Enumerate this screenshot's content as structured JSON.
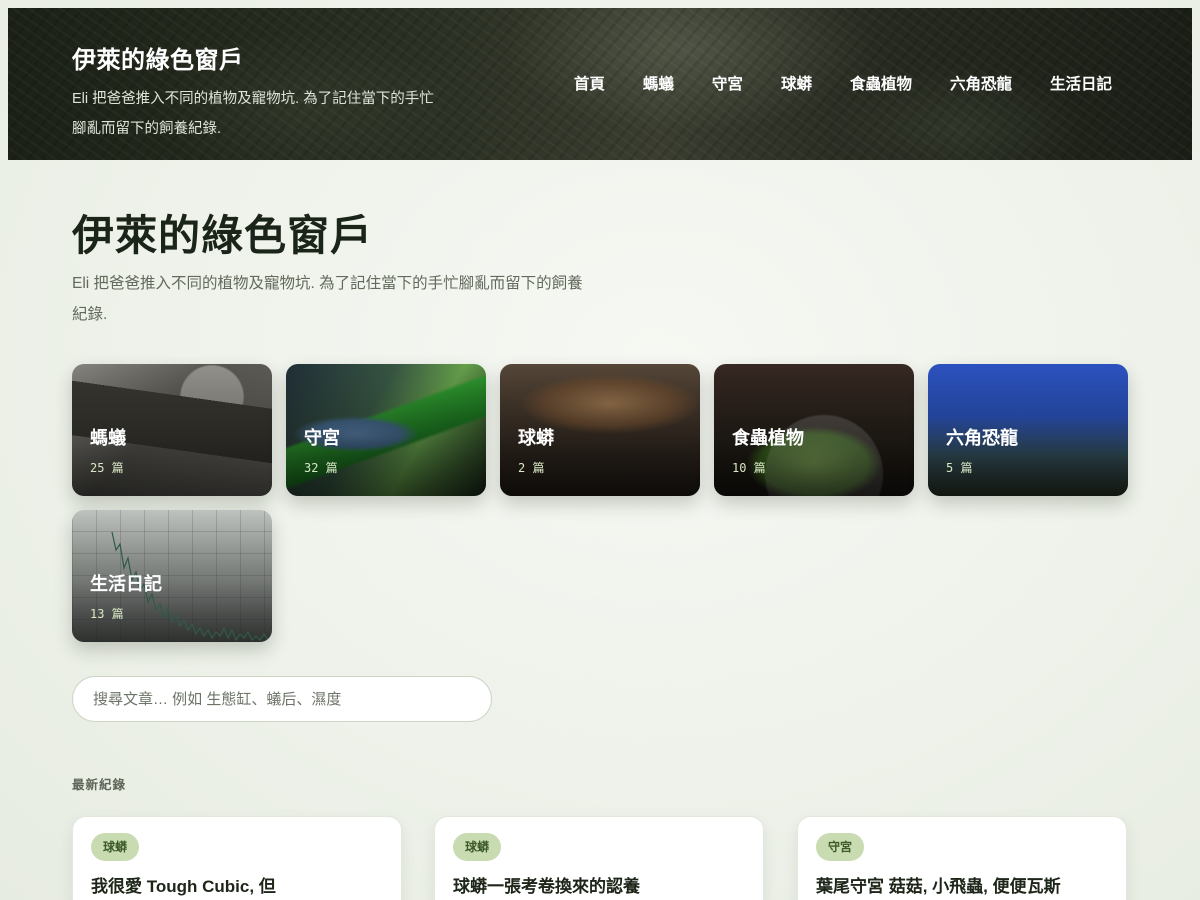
{
  "header": {
    "site_title": "伊萊的綠色窗戶",
    "site_description": "Eli 把爸爸推入不同的植物及寵物坑. 為了記住當下的手忙腳亂而留下的飼養紀錄.",
    "nav": [
      "首頁",
      "螞蟻",
      "守宮",
      "球蟒",
      "食蟲植物",
      "六角恐龍",
      "生活日記"
    ]
  },
  "hero": {
    "title": "伊萊的綠色窗戶",
    "description": "Eli 把爸爸推入不同的植物及寵物坑. 為了記住當下的手忙腳亂而留下的飼養紀錄."
  },
  "categories": [
    {
      "name": "螞蟻",
      "count": "25 篇"
    },
    {
      "name": "守宮",
      "count": "32 篇"
    },
    {
      "name": "球蟒",
      "count": "2 篇"
    },
    {
      "name": "食蟲植物",
      "count": "10 篇"
    },
    {
      "name": "六角恐龍",
      "count": "5 篇"
    },
    {
      "name": "生活日記",
      "count": "13 篇"
    }
  ],
  "search": {
    "placeholder": "搜尋文章… 例如 生態缸、蟻后、濕度",
    "value": ""
  },
  "latest": {
    "label": "最新紀錄",
    "posts": [
      {
        "tag": "球蟒",
        "title": "我很愛 Tough Cubic, 但"
      },
      {
        "tag": "球蟒",
        "title": "球蟒一張考卷換來的認養"
      },
      {
        "tag": "守宮",
        "title": "葉尾守宮 菇菇, 小飛蟲, 便便瓦斯"
      }
    ]
  }
}
